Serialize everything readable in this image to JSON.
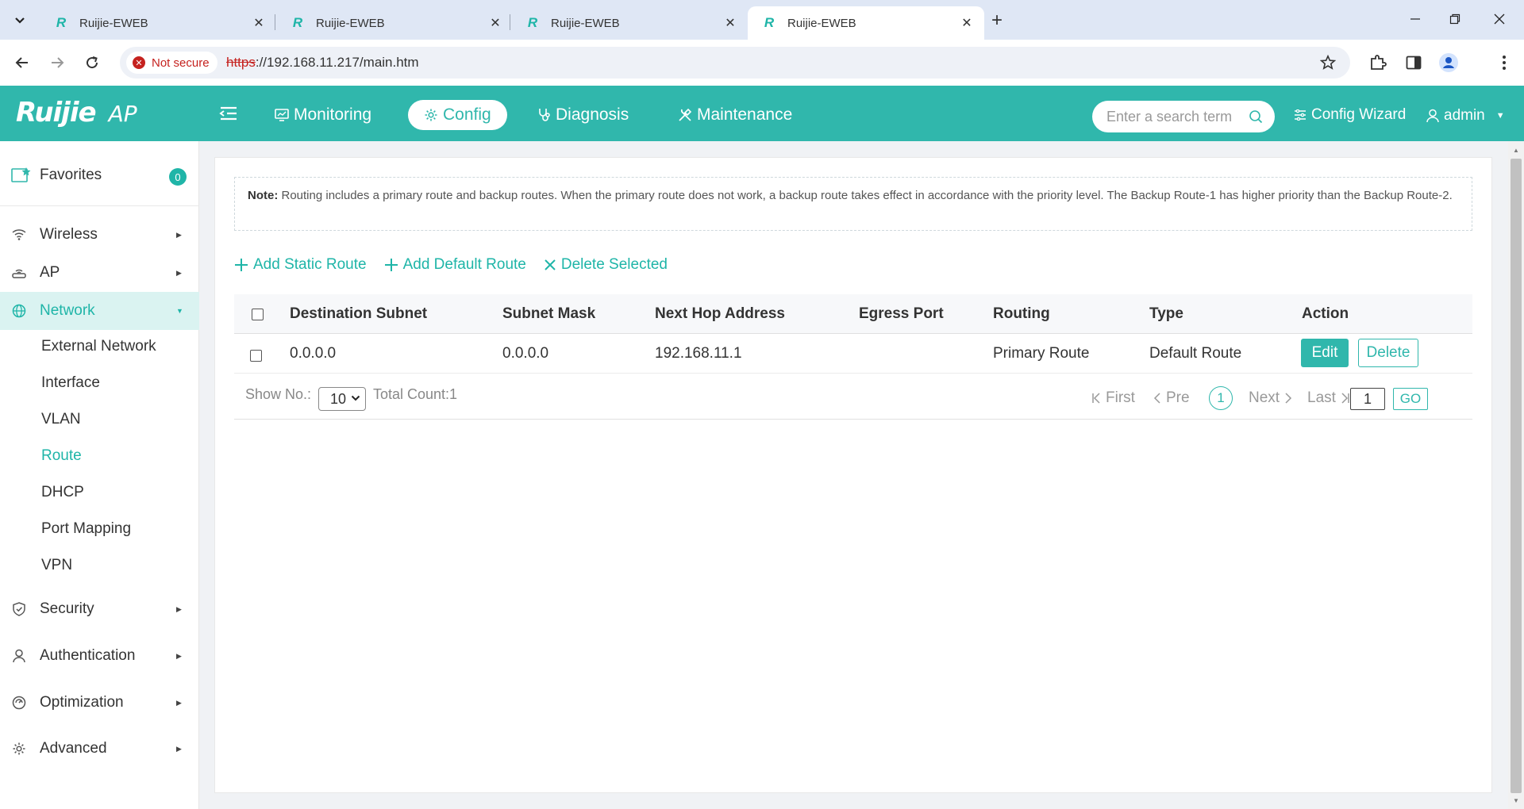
{
  "browser": {
    "tabs": [
      {
        "title": "Ruijie-EWEB",
        "active": false
      },
      {
        "title": "Ruijie-EWEB",
        "active": false
      },
      {
        "title": "Ruijie-EWEB",
        "active": false
      },
      {
        "title": "Ruijie-EWEB",
        "active": true
      }
    ],
    "security_label": "Not secure",
    "url_scheme": "https",
    "url_rest": "://192.168.11.217/main.htm"
  },
  "header": {
    "brand": "Ruijie",
    "product": "AP",
    "nav": [
      {
        "label": "Monitoring",
        "active": false
      },
      {
        "label": "Config",
        "active": true
      },
      {
        "label": "Diagnosis",
        "active": false
      },
      {
        "label": "Maintenance",
        "active": false
      }
    ],
    "search_placeholder": "Enter a search term",
    "wizard_label": "Config Wizard",
    "user_label": "admin"
  },
  "sidebar": {
    "favorites_label": "Favorites",
    "favorites_count": "0",
    "items": [
      {
        "label": "Wireless",
        "icon": "wifi-icon"
      },
      {
        "label": "AP",
        "icon": "ap-icon"
      },
      {
        "label": "Network",
        "icon": "globe-icon",
        "active": true
      },
      {
        "label": "Security",
        "icon": "shield-icon"
      },
      {
        "label": "Authentication",
        "icon": "user-icon"
      },
      {
        "label": "Optimization",
        "icon": "optimization-icon"
      },
      {
        "label": "Advanced",
        "icon": "gear-icon"
      }
    ],
    "network_sub": [
      {
        "label": "External Network"
      },
      {
        "label": "Interface"
      },
      {
        "label": "VLAN"
      },
      {
        "label": "Route",
        "active": true
      },
      {
        "label": "DHCP"
      },
      {
        "label": "Port Mapping"
      },
      {
        "label": "VPN"
      }
    ]
  },
  "main": {
    "note_title": "Note:",
    "note_text": "Routing includes a primary route and backup routes. When the primary route does not work, a backup route takes effect in accordance with the priority level. The Backup Route-1 has higher priority than the Backup Route-2.",
    "actions": {
      "add_static": "Add Static Route",
      "add_default": "Add Default Route",
      "delete_selected": "Delete Selected"
    },
    "table": {
      "columns": [
        "Destination Subnet",
        "Subnet Mask",
        "Next Hop Address",
        "Egress Port",
        "Routing",
        "Type",
        "Action"
      ],
      "rows": [
        {
          "destination": "0.0.0.0",
          "mask": "0.0.0.0",
          "next_hop": "192.168.11.1",
          "egress": "",
          "routing": "Primary Route",
          "type": "Default Route",
          "edit": "Edit",
          "delete": "Delete"
        }
      ]
    },
    "pager": {
      "show_label": "Show No.:",
      "page_size": "10",
      "total_label": "Total Count:1",
      "first": "First",
      "prev": "Pre",
      "current": "1",
      "next": "Next",
      "last": "Last",
      "goto_value": "1",
      "go": "GO"
    }
  }
}
